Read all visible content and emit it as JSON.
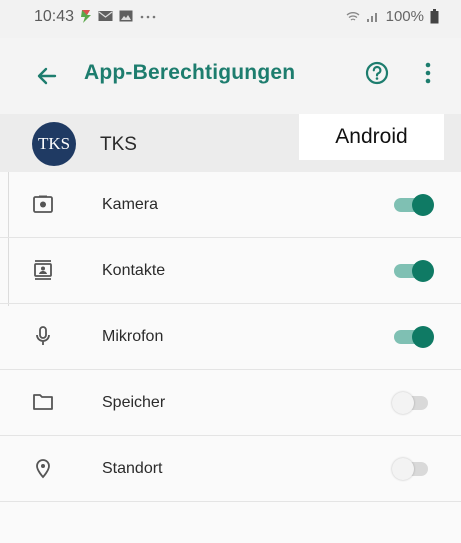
{
  "status_bar": {
    "time": "10:43",
    "icons": [
      "flash-notification-icon",
      "mail-icon",
      "gallery-icon",
      "more-dots-icon"
    ],
    "battery": "100%",
    "right_icons": [
      "wifi-icon",
      "signal-icon",
      "battery-icon"
    ]
  },
  "app_bar": {
    "title": "App-Berechtigungen",
    "back_icon": "arrow-left-icon",
    "help_icon": "help-circle-icon",
    "menu_icon": "more-vert-icon",
    "accent": "#1d7d6e"
  },
  "app": {
    "logo_text": "TKS",
    "name": "TKS",
    "platform_label": "Android"
  },
  "permissions": [
    {
      "label": "Kamera",
      "icon": "camera-icon",
      "enabled": true
    },
    {
      "label": "Kontakte",
      "icon": "contacts-icon",
      "enabled": true
    },
    {
      "label": "Mikrofon",
      "icon": "microphone-icon",
      "enabled": true
    },
    {
      "label": "Speicher",
      "icon": "folder-icon",
      "enabled": false
    },
    {
      "label": "Standort",
      "icon": "location-icon",
      "enabled": false
    }
  ],
  "colors": {
    "toggle_on": "#0f7a64",
    "toggle_on_track": "#7fc0b3",
    "toggle_off": "#d9d9d9",
    "logo_bg": "#1f3a63"
  }
}
